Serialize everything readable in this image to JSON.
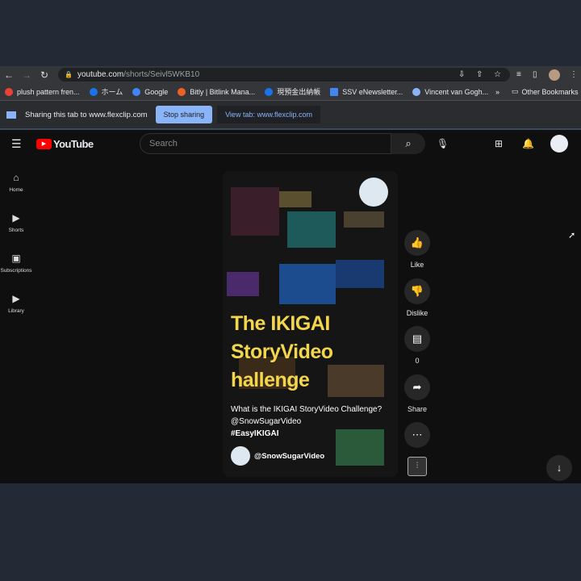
{
  "browser": {
    "url_host": "youtube.com",
    "url_path": "/shorts/Seivl5WKB10"
  },
  "bookmarks": [
    {
      "label": "plush pattern fren...",
      "color": "#ea4335"
    },
    {
      "label": "ホーム",
      "color": "#1a73e8"
    },
    {
      "label": "Google",
      "color": "#4285f4"
    },
    {
      "label": "Bitly | Bitlink Mana...",
      "color": "#ee6123"
    },
    {
      "label": "現預金出納帳",
      "color": "#1a73e8"
    },
    {
      "label": "SSV eNewsletter...",
      "color": "#4285f4"
    },
    {
      "label": "Vincent van Gogh...",
      "color": "#8ab4f8"
    }
  ],
  "bookmarks_more": "»",
  "other_bookmarks": "Other Bookmarks",
  "sharing": {
    "text": "Sharing this tab to www.flexclip.com",
    "stop": "Stop sharing",
    "view": "View tab: www.flexclip.com"
  },
  "youtube": {
    "logo": "YouTube",
    "search_placeholder": "Search",
    "sidebar": [
      {
        "label": "Home",
        "icon": "⌂"
      },
      {
        "label": "Shorts",
        "icon": "▶"
      },
      {
        "label": "Subscriptions",
        "icon": "▣"
      },
      {
        "label": "Library",
        "icon": "▶"
      }
    ],
    "video": {
      "title_lines": [
        "The IKIGAI",
        "StoryVideo",
        "hallenge"
      ],
      "caption": "What is the IKIGAI StoryVideo Challenge? @SnowSugarVideo",
      "hashtag": "#EasyIKIGAI",
      "channel": "@SnowSugarVideo"
    },
    "actions": {
      "like": "Like",
      "dislike": "Dislike",
      "comments": "0",
      "share": "Share"
    }
  }
}
